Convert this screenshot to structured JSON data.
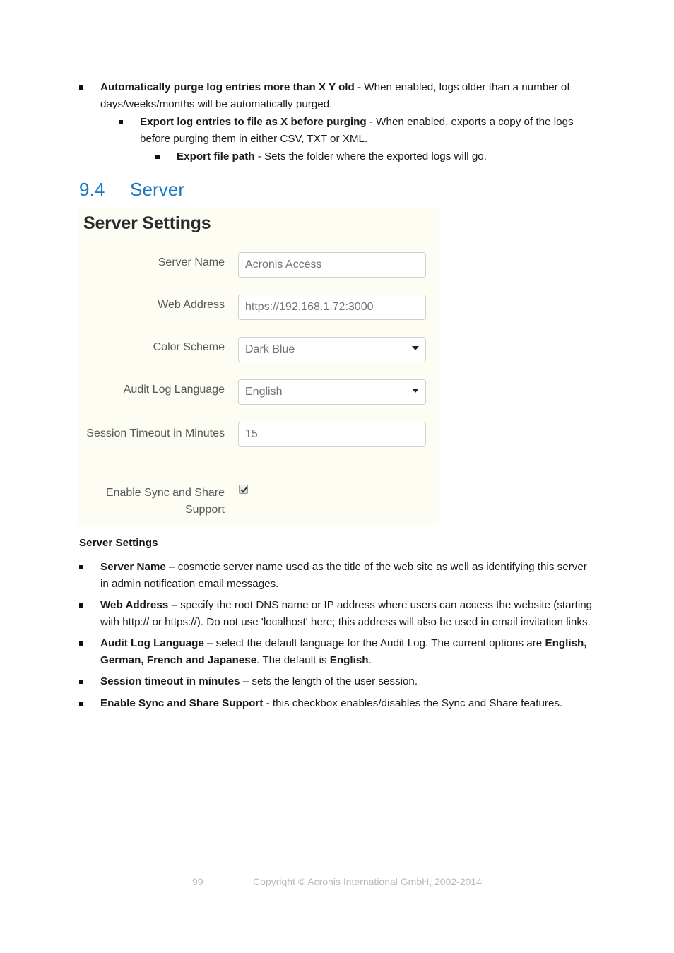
{
  "top_bullets": [
    {
      "level": 1,
      "bold": "Automatically purge log entries more than X Y old",
      "rest": " - When enabled, logs older than a number of days/weeks/months will be automatically purged."
    },
    {
      "level": 2,
      "bold": "Export log entries to file as X    before purging",
      "rest": " - When enabled, exports a copy of the logs before purging them in either CSV, TXT or XML."
    },
    {
      "level": 3,
      "bold": "Export file path",
      "rest": " - Sets the folder where the exported logs will go."
    }
  ],
  "heading": {
    "number": "9.4",
    "text": "Server",
    "color": "#1878c0"
  },
  "screenshot": {
    "title": "Server Settings",
    "background": "#fdfdf4",
    "fields": [
      {
        "label": "Server Name",
        "value": "Acronis Access",
        "type": "text"
      },
      {
        "label": "Web Address",
        "value": "https://192.168.1.72:3000",
        "type": "text"
      },
      {
        "label": "Color Scheme",
        "value": "Dark Blue",
        "type": "select"
      },
      {
        "label": "Audit Log Language",
        "value": "English",
        "type": "select"
      },
      {
        "label": "Session Timeout in Minutes",
        "value": "15",
        "type": "text"
      },
      {
        "label": "Enable Sync and Share Support",
        "value": "",
        "type": "checkbox",
        "checked": true
      }
    ]
  },
  "lower": {
    "subheading": "Server Settings",
    "bullets": [
      {
        "bold": "Server Name",
        "rest": " – cosmetic server name used as the title of the web site as well as identifying this server in admin notification email messages."
      },
      {
        "bold": "Web Address",
        "rest": " – specify the root DNS name or IP address where users can access the website (starting with http:// or https://). Do not use 'localhost' here; this address will also be used in email invitation links."
      },
      {
        "bold": "Audit Log Language",
        "rest": "    – select the default language for the Audit Log. The current options are ",
        "bold2": "English, German, French and Japanese",
        "rest2": ". The default is ",
        "bold3": "English",
        "rest3": "."
      },
      {
        "bold": "Session timeout in minutes",
        "rest": " – sets the length of the user session."
      },
      {
        "bold": "Enable Sync and Share Support",
        "rest": " - this checkbox enables/disables the Sync and Share features."
      }
    ]
  },
  "footer": {
    "page_number": "99",
    "copyright": "Copyright © Acronis International GmbH, 2002-2014"
  }
}
